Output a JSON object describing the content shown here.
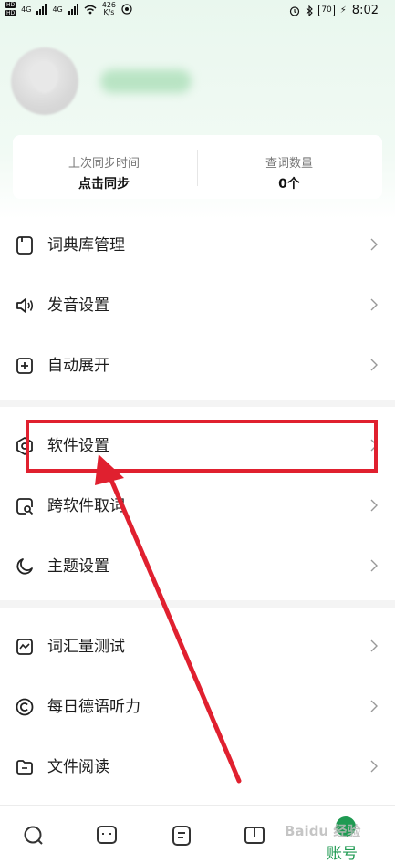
{
  "status_bar": {
    "hd1": "HD",
    "hd2": "HD",
    "net1": "4G",
    "net2": "4G",
    "speed_value": "426",
    "speed_unit": "K/s",
    "battery": "70",
    "time": "8:02"
  },
  "stats": {
    "sync_label": "上次同步时间",
    "sync_value": "点击同步",
    "words_label": "查词数量",
    "words_value": "0个"
  },
  "menu": {
    "group1": [
      "词典库管理",
      "发音设置",
      "自动展开"
    ],
    "group2": [
      "软件设置",
      "跨软件取词",
      "主题设置"
    ],
    "group3": [
      "词汇量测试",
      "每日德语听力",
      "文件阅读"
    ]
  },
  "bottom_nav": {
    "account_label": "账号"
  },
  "watermark": "Baidu 经验",
  "colors": {
    "accent": "#1f9a52",
    "annotation": "#e0202f",
    "header_bg": "#e9f7ee"
  }
}
